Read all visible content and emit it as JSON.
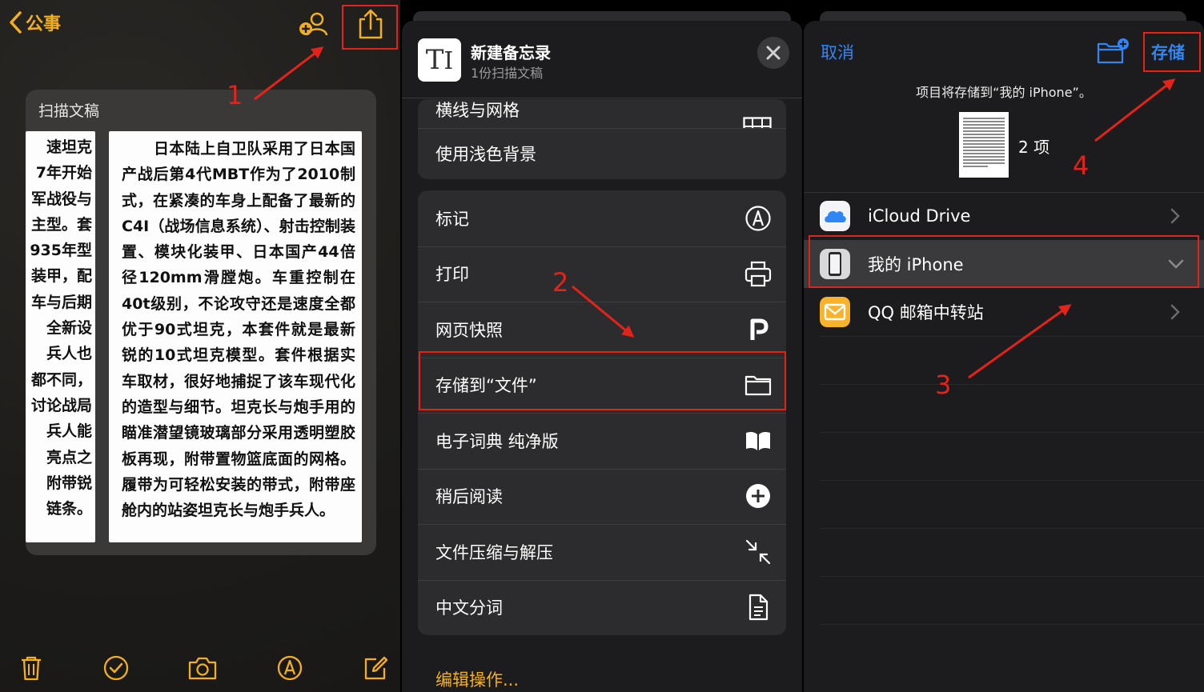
{
  "notes": {
    "back_label": "公事",
    "card_title": "扫描文稿",
    "page_a_lines": [
      "速坦克",
      "7年开始",
      "军战役与",
      "主型。套",
      "935年型",
      "装甲，配",
      "车与后期",
      "全新设",
      "兵人也",
      "都不同，",
      "讨论战局",
      "兵人能",
      "亮点之",
      "附带锐",
      "链条。"
    ],
    "page_b_text": "日本陆上自卫队采用了日本国产战后第4代MBT作为了2010制式，在紧凑的车身上配备了最新的C4I（战场信息系统）、射击控制装置、模块化装甲、日本国产44倍径120mm滑膛炮。车重控制在40t级别，不论攻守还是速度全都优于90式坦克，本套件就是最新锐的10式坦克模型。套件根据实车取材，很好地捕捉了该车现代化的造型与细节。坦克长与炮手用的瞄准潜望镜玻璃部分采用透明塑胶板再现，附带置物篮底面的网格。履带为可轻松安装的带式，附带座舱内的站姿坦克长与炮手兵人。"
  },
  "share_sheet": {
    "title": "新建备忘录",
    "subtitle": "1份扫描文稿",
    "cut_row": "横线与网格",
    "group1": [
      "使用浅色背景"
    ],
    "group2": [
      {
        "label": "标记",
        "icon": "markup-icon"
      },
      {
        "label": "打印",
        "icon": "print-icon"
      },
      {
        "label": "网页快照",
        "icon": "p-icon"
      },
      {
        "label": "存储到“文件”",
        "icon": "folder-icon"
      },
      {
        "label": "电子词典 纯净版",
        "icon": "book-icon"
      },
      {
        "label": "稍后阅读",
        "icon": "plus-circle-icon"
      },
      {
        "label": "文件压缩与解压",
        "icon": "compress-icon"
      },
      {
        "label": "中文分词",
        "icon": "document-icon"
      }
    ],
    "edit_actions": "编辑操作..."
  },
  "files": {
    "cancel": "取消",
    "save": "存储",
    "note": "项目将存储到“我的 iPhone”。",
    "item_count": "2 项",
    "locations": [
      {
        "label": "iCloud Drive",
        "icon": "icloud-icon"
      },
      {
        "label": "我的 iPhone",
        "icon": "iphone-icon"
      },
      {
        "label": "QQ 邮箱中转站",
        "icon": "mail-icon"
      }
    ]
  },
  "annotations": [
    "1",
    "2",
    "3",
    "4"
  ],
  "colors": {
    "accent_yellow": "#f2b01e",
    "ios_blue": "#2f86f6",
    "annotation_red": "#e3231a"
  }
}
